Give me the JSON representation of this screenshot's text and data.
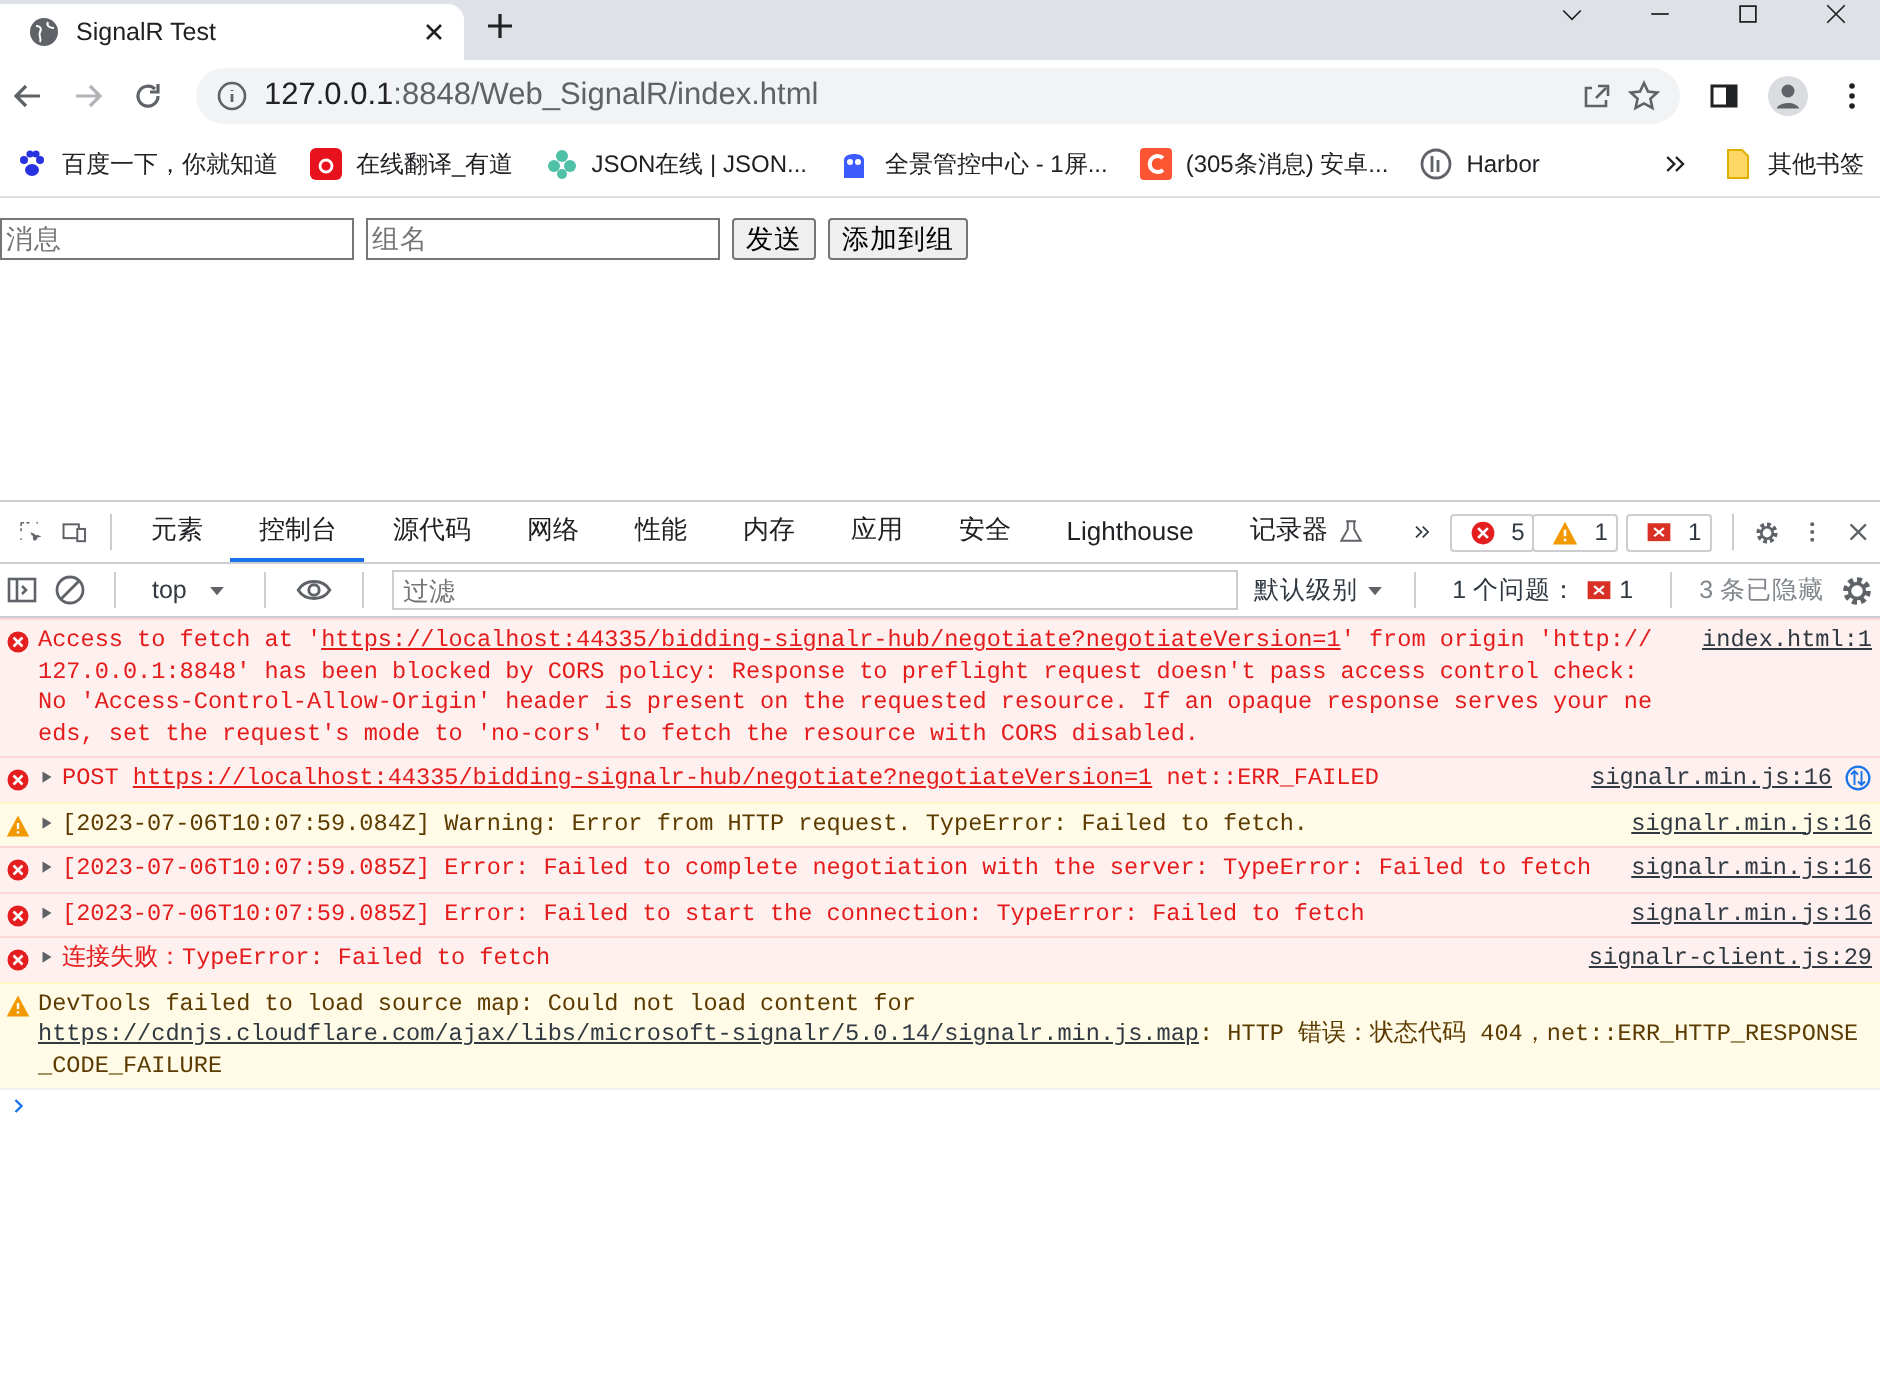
{
  "browser": {
    "tab_title": "SignalR Test",
    "address_host": "127.0.0.1",
    "address_rest": ":8848/Web_SignalR/index.html",
    "bookmarks": [
      {
        "label": "百度一下，你就知道"
      },
      {
        "label": "在线翻译_有道"
      },
      {
        "label": "JSON在线 | JSON..."
      },
      {
        "label": "全景管控中心 - 1屏..."
      },
      {
        "label": "(305条消息) 安卓..."
      },
      {
        "label": "Harbor"
      }
    ],
    "other_bookmarks": "其他书签"
  },
  "page": {
    "fields": [
      {
        "placeholder": "消息"
      },
      {
        "placeholder": "组名"
      }
    ],
    "buttons": [
      "发送",
      "添加到组"
    ]
  },
  "devtools": {
    "tabs": [
      {
        "label": "元素",
        "selected": false
      },
      {
        "label": "控制台",
        "selected": true
      },
      {
        "label": "源代码",
        "selected": false
      },
      {
        "label": "网络",
        "selected": false
      },
      {
        "label": "性能",
        "selected": false
      },
      {
        "label": "内存",
        "selected": false
      },
      {
        "label": "应用",
        "selected": false
      },
      {
        "label": "安全",
        "selected": false
      },
      {
        "label": "Lighthouse",
        "selected": false
      },
      {
        "label": "记录器",
        "selected": false
      }
    ],
    "error_count": "5",
    "warning_count": "1",
    "issue_count": "1",
    "context": "top",
    "filter_placeholder": "过滤",
    "level_menu": "默认级别",
    "issues_label": "1 个问题：",
    "issues_count": "1",
    "hidden_count": "3 条已隐藏",
    "messages": [
      {
        "kind": "error",
        "expandable": false,
        "source": "index.html:1",
        "parts": [
          {
            "text": "Access to fetch at '",
            "kind": "text"
          },
          {
            "text": "https://localhost:44335/bidding-signalr-hub/negotiate?negotiateVersion=1",
            "kind": "link"
          },
          {
            "text": "' from origin 'http://127.0.0.1:8848' has been blocked by CORS policy: Response to preflight request doesn't pass access control check: No 'Access-Control-Allow-Origin' header is present on the requested resource. If an opaque response serves your needs, set the request's mode to 'no-cors' to fetch the resource with CORS disabled.",
            "kind": "text"
          }
        ]
      },
      {
        "kind": "error",
        "expandable": true,
        "source": "signalr.min.js:16",
        "network": true,
        "parts": [
          {
            "text": "POST ",
            "kind": "text"
          },
          {
            "text": "https://localhost:44335/bidding-signalr-hub/negotiate?negotiateVersion=1",
            "kind": "link"
          },
          {
            "text": " net::ERR_FAILED",
            "kind": "text"
          }
        ]
      },
      {
        "kind": "warning",
        "expandable": true,
        "source": "signalr.min.js:16",
        "parts": [
          {
            "text": "[2023-07-06T10:07:59.084Z] Warning: Error from HTTP request. TypeError: Failed to fetch.",
            "kind": "text"
          }
        ]
      },
      {
        "kind": "error",
        "expandable": true,
        "source": "signalr.min.js:16",
        "parts": [
          {
            "text": "[2023-07-06T10:07:59.085Z] Error: Failed to complete negotiation with the server: TypeError: Failed to fetch",
            "kind": "text"
          }
        ]
      },
      {
        "kind": "error",
        "expandable": true,
        "source": "signalr.min.js:16",
        "parts": [
          {
            "text": "[2023-07-06T10:07:59.085Z] Error: Failed to start the connection: TypeError: Failed to fetch",
            "kind": "text"
          }
        ]
      },
      {
        "kind": "error",
        "expandable": true,
        "source": "signalr-client.js:29",
        "parts": [
          {
            "text": "连接失败：TypeError: Failed to fetch",
            "kind": "text"
          }
        ]
      },
      {
        "kind": "warning",
        "expandable": false,
        "parts": [
          {
            "text": "DevTools failed to load source map: Could not load content for ",
            "kind": "text"
          },
          {
            "text": "https://cdnjs.cloudflare.com/ajax/libs/microsoft-signalr/5.0.14/signalr.min.js.map",
            "kind": "link"
          },
          {
            "text": ": HTTP 错误：状态代码 404，net::ERR_HTTP_RESPONSE_CODE_FAILURE",
            "kind": "text"
          }
        ]
      }
    ]
  }
}
